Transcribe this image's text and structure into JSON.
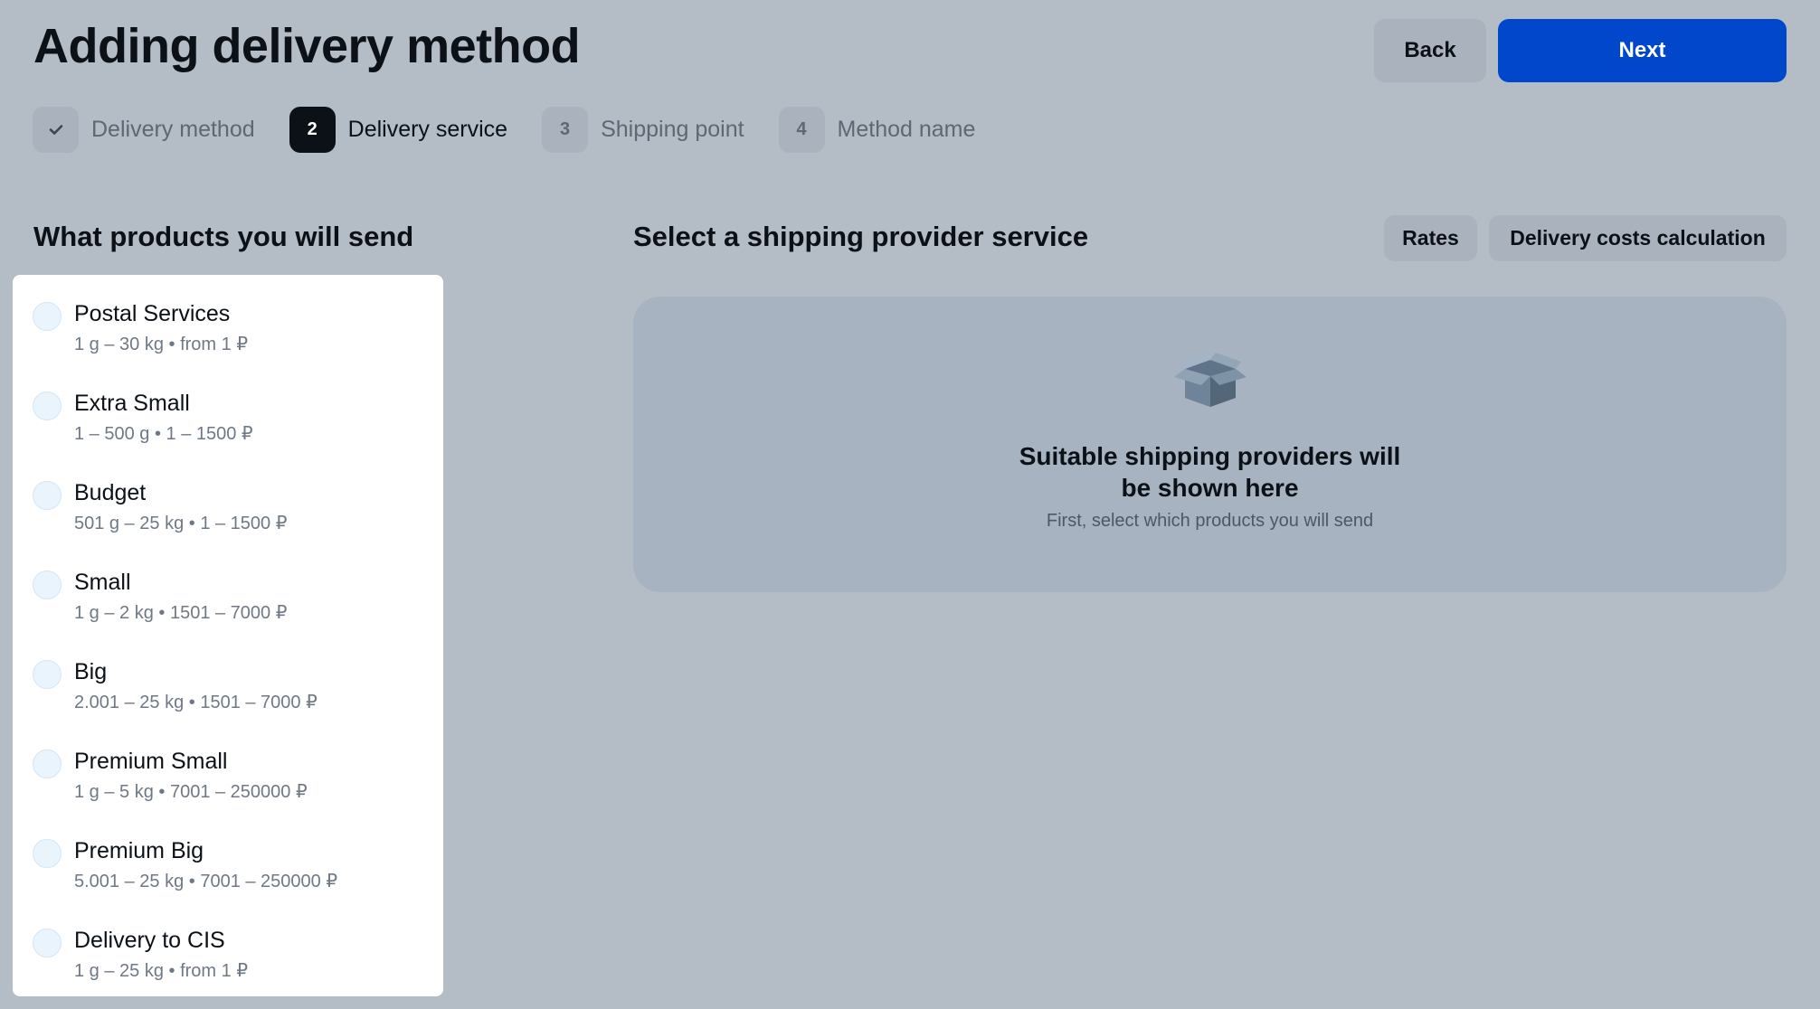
{
  "header": {
    "title": "Adding delivery method",
    "back_label": "Back",
    "next_label": "Next"
  },
  "steps": [
    {
      "badge": "",
      "label": "Delivery method",
      "state": "done",
      "icon": "check-icon"
    },
    {
      "badge": "2",
      "label": "Delivery service",
      "state": "active"
    },
    {
      "badge": "3",
      "label": "Shipping point",
      "state": "pending"
    },
    {
      "badge": "4",
      "label": "Method name",
      "state": "pending"
    }
  ],
  "products_section": {
    "title": "What products you will send",
    "items": [
      {
        "name": "Postal Services",
        "desc": "1 g – 30 kg • from 1 ₽"
      },
      {
        "name": "Extra Small",
        "desc": "1 – 500 g • 1 – 1500 ₽"
      },
      {
        "name": "Budget",
        "desc": "501 g – 25 kg • 1 – 1500 ₽"
      },
      {
        "name": "Small",
        "desc": "1 g – 2 kg • 1501 – 7000 ₽"
      },
      {
        "name": "Big",
        "desc": "2.001 – 25 kg • 1501 – 7000 ₽"
      },
      {
        "name": "Premium Small",
        "desc": "1 g – 5 kg • 7001 – 250000 ₽"
      },
      {
        "name": "Premium Big",
        "desc": "5.001 – 25 kg • 7001 – 250000 ₽"
      },
      {
        "name": "Delivery to CIS",
        "desc": "1 g – 25 kg • from 1 ₽"
      }
    ]
  },
  "provider_section": {
    "title": "Select a shipping provider service",
    "rates_label": "Rates",
    "calc_label": "Delivery costs calculation",
    "empty_icon": "box-icon",
    "empty_title": "Suitable shipping providers will be shown here",
    "empty_subtitle": "First, select which products you will send"
  },
  "colors": {
    "background": "#b4bcc5",
    "primary": "#0047cc",
    "dark": "#0b1117",
    "muted": "#5d6875",
    "panel": "#a7b3c1"
  }
}
